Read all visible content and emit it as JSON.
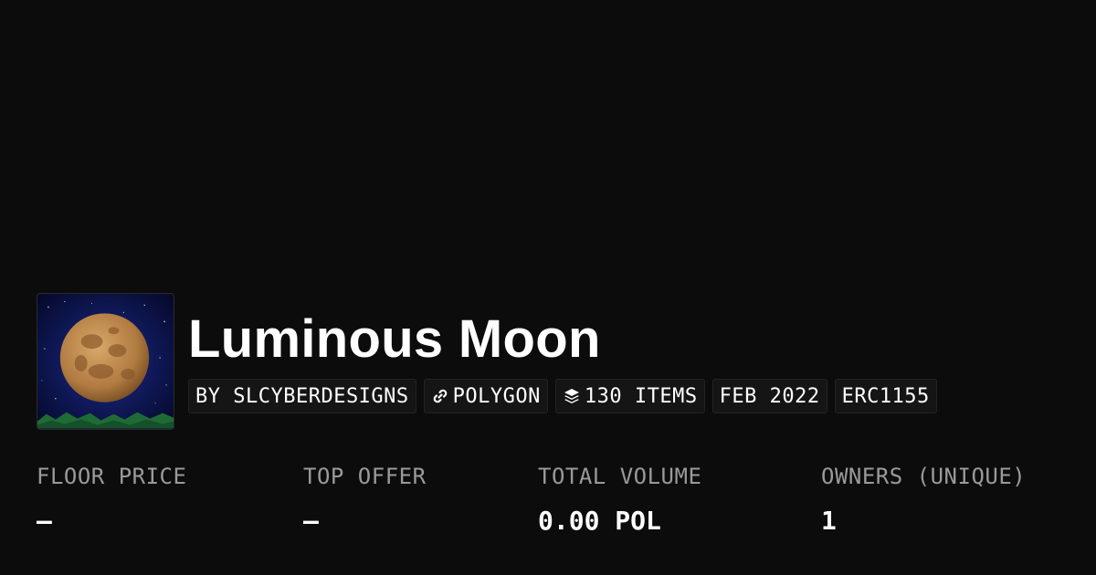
{
  "collection": {
    "title": "Luminous Moon",
    "thumbnail_alt": "moon-artwork"
  },
  "tags": [
    {
      "label": "BY SLCYBERDESIGNS",
      "icon": ""
    },
    {
      "label": "POLYGON",
      "icon": "chain-link-icon"
    },
    {
      "label": "130 ITEMS",
      "icon": "layers-icon"
    },
    {
      "label": "FEB 2022",
      "icon": ""
    },
    {
      "label": "ERC1155",
      "icon": ""
    }
  ],
  "stats": [
    {
      "label": "FLOOR PRICE",
      "value": "–"
    },
    {
      "label": "TOP OFFER",
      "value": "–"
    },
    {
      "label": "TOTAL VOLUME",
      "value": "0.00 POL"
    },
    {
      "label": "OWNERS (UNIQUE)",
      "value": "1"
    }
  ],
  "colors": {
    "background": "#0c0c0c",
    "tag_background": "#151515",
    "label_gray": "#9a9a9a",
    "text": "#ffffff"
  }
}
